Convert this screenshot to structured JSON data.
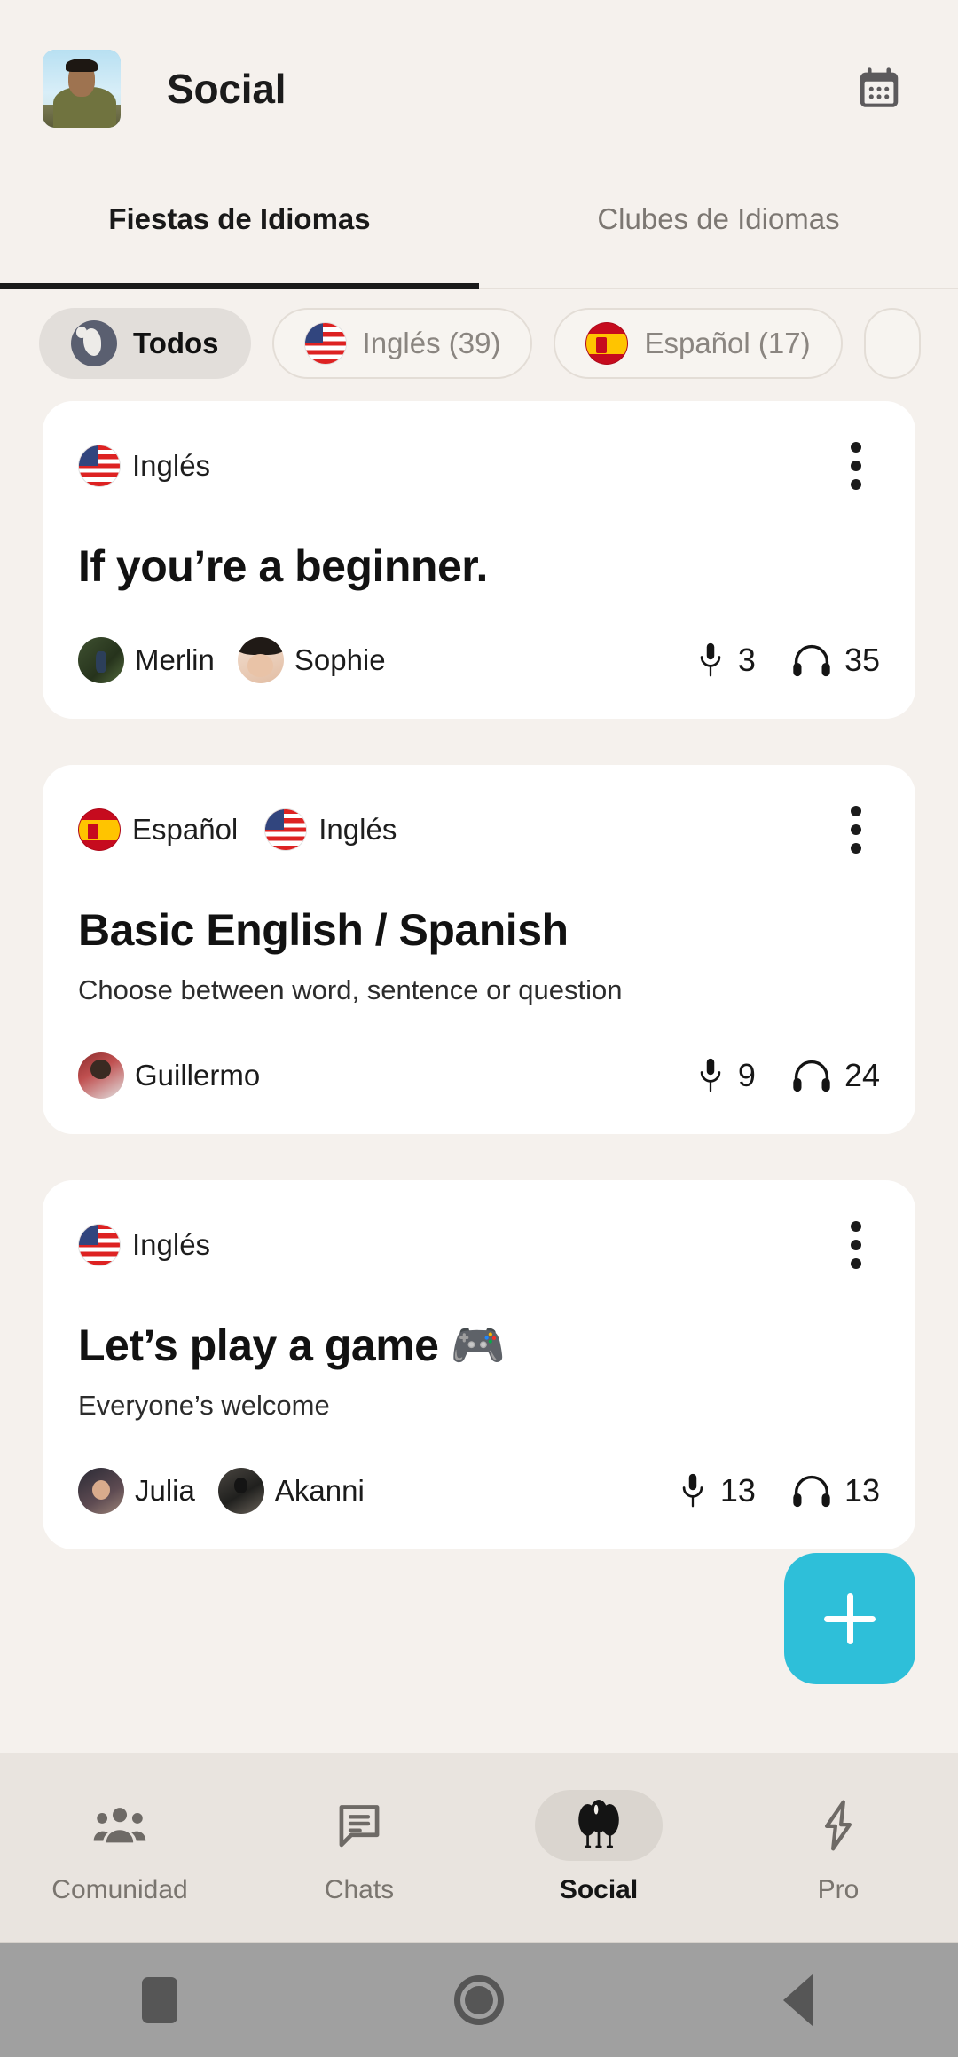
{
  "header": {
    "title": "Social",
    "avatar_name": "user-avatar",
    "calendar_icon": "calendar-icon"
  },
  "tabs": [
    {
      "label": "Fiestas de Idiomas",
      "active": true
    },
    {
      "label": "Clubes de Idiomas",
      "active": false
    }
  ],
  "filter_chips": [
    {
      "label": "Todos",
      "icon": "globe-icon",
      "selected": true
    },
    {
      "label": "Inglés (39)",
      "icon": "flag-us-icon",
      "selected": false
    },
    {
      "label": "Español (17)",
      "icon": "flag-es-icon",
      "selected": false
    }
  ],
  "cards": [
    {
      "languages": [
        {
          "name": "Inglés",
          "flag": "flag-us-icon"
        }
      ],
      "title": "If you’re a beginner.",
      "subtitle": "",
      "speakers": [
        {
          "name": "Merlin",
          "avatar": "avatar-merlin"
        },
        {
          "name": "Sophie",
          "avatar": "avatar-sophie"
        }
      ],
      "speaker_count": "3",
      "listener_count": "35"
    },
    {
      "languages": [
        {
          "name": "Español",
          "flag": "flag-es-icon"
        },
        {
          "name": "Inglés",
          "flag": "flag-us-icon"
        }
      ],
      "title": "Basic English / Spanish",
      "subtitle": "Choose between word, sentence or question",
      "speakers": [
        {
          "name": "Guillermo",
          "avatar": "avatar-guillermo"
        }
      ],
      "speaker_count": "9",
      "listener_count": "24"
    },
    {
      "languages": [
        {
          "name": "Inglés",
          "flag": "flag-us-icon"
        }
      ],
      "title": "Let’s play a game 🎮",
      "subtitle": "Everyone’s welcome",
      "speakers": [
        {
          "name": "Julia",
          "avatar": "avatar-julia"
        },
        {
          "name": "Akanni",
          "avatar": "avatar-akanni"
        }
      ],
      "speaker_count": "13",
      "listener_count": "13"
    }
  ],
  "fab": {
    "label": "+",
    "icon": "plus-icon",
    "color": "#2EBFD9"
  },
  "bottom_nav": [
    {
      "label": "Comunidad",
      "icon": "people-icon",
      "active": false
    },
    {
      "label": "Chats",
      "icon": "chat-bubble-icon",
      "active": false
    },
    {
      "label": "Social",
      "icon": "balloons-icon",
      "active": true
    },
    {
      "label": "Pro",
      "icon": "lightning-bolt-icon",
      "active": false
    }
  ],
  "system_nav": [
    {
      "icon": "recents-square-icon"
    },
    {
      "icon": "home-circle-icon"
    },
    {
      "icon": "back-triangle-icon"
    }
  ],
  "colors": {
    "background": "#F5F1ED",
    "card": "#FFFFFF",
    "accent": "#2EBFD9",
    "nav_bg": "#E9E4DF",
    "text_primary": "#161616",
    "text_muted": "#8A8580"
  }
}
